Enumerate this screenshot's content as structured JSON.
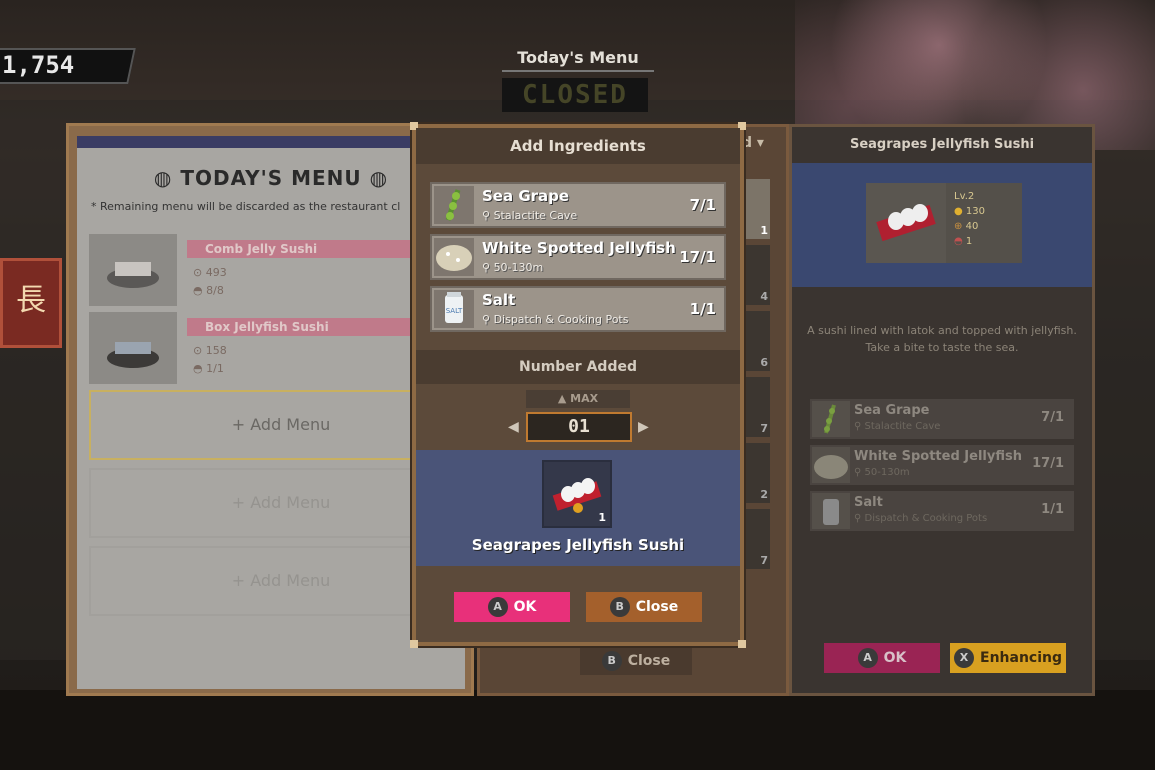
{
  "hud": {
    "coins": "1,754"
  },
  "header": {
    "title": "Today's Menu",
    "status": "CLOSED"
  },
  "left_panel": {
    "title": "TODAY'S MENU",
    "note": "* Remaining menu will be discarded as the restaurant cl",
    "items": [
      {
        "name": "Comb Jelly Sushi",
        "price": "493",
        "count": "8/8"
      },
      {
        "name": "Box Jellyfish Sushi",
        "price": "158",
        "count": "1/1"
      }
    ],
    "add_menu_label": "+ Add Menu"
  },
  "middle_panel": {
    "header_fragment": "d",
    "close_label": "Close",
    "close_key": "B",
    "counts": [
      "1",
      "4",
      "6",
      "7",
      "2",
      "7"
    ]
  },
  "right_panel": {
    "title": "Seagrapes Jellyfish Sushi",
    "level": "Lv.2",
    "price": "130",
    "taste": "40",
    "quantity": "1",
    "description_line1": "A sushi lined with latok and topped with jellyfish.",
    "description_line2": "Take a bite to taste the sea.",
    "ingredients": [
      {
        "name": "Sea Grape",
        "location": "Stalactite Cave",
        "count": "7/1"
      },
      {
        "name": "White Spotted Jellyfish",
        "location": "50-130m",
        "count": "17/1"
      },
      {
        "name": "Salt",
        "location": "Dispatch & Cooking Pots",
        "count": "1/1"
      }
    ],
    "ok_label": "OK",
    "ok_key": "A",
    "enhance_label": "Enhancing",
    "enhance_key": "X"
  },
  "modal": {
    "title": "Add Ingredients",
    "ingredients": [
      {
        "name": "Sea Grape",
        "location": "Stalactite Cave",
        "count": "7/1"
      },
      {
        "name": "White Spotted Jellyfish",
        "location": "50-130m",
        "count": "17/1"
      },
      {
        "name": "Salt",
        "location": "Dispatch & Cooking Pots",
        "count": "1/1",
        "icon_text": "SALT"
      }
    ],
    "number_added_label": "Number Added",
    "max_label": "▲ MAX",
    "number_value": "01",
    "result": {
      "name": "Seagrapes Jellyfish Sushi",
      "quantity": "1"
    },
    "ok_label": "OK",
    "ok_key": "A",
    "close_label": "Close",
    "close_key": "B"
  },
  "colors": {
    "accent_pink": "#e8307a",
    "close_brown": "#a4602c",
    "enhance_yellow": "#d8a020",
    "result_blue": "#4a5478"
  }
}
